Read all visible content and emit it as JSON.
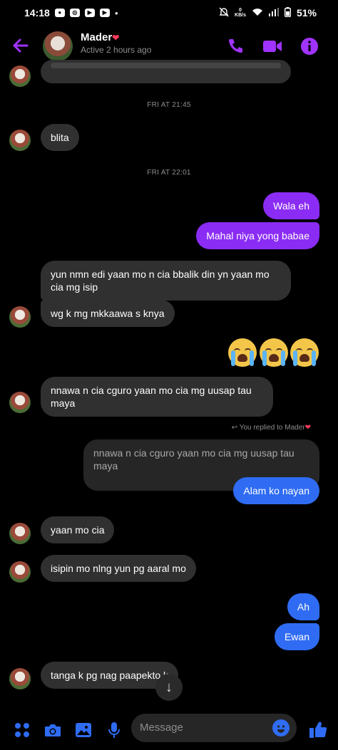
{
  "status_bar": {
    "time": "14:18",
    "kbs_value": "0",
    "kbs_unit": "KB/s",
    "battery": "51%"
  },
  "header": {
    "name": "Mader",
    "heart": "❤",
    "status": "Active 2 hours ago"
  },
  "timestamps": {
    "first": "FRI AT 21:45",
    "second": "FRI AT 22:01"
  },
  "messages": {
    "m1": "blita",
    "m2": "Wala eh",
    "m3": "Mahal niya yong babae",
    "m4": "yun nmn edi yaan mo n cia bbalik din yn yaan mo cia mg isip",
    "m5": "wg k mg mkkaawa s knya",
    "m6": "nnawa n cia cguro yaan mo cia mg uusap tau maya",
    "reply_note": "You replied to Mader",
    "quoted": "nnawa n cia cguro yaan mo cia mg uusap tau maya",
    "m7": "Alam ko nayan",
    "m8": "yaan mo cia",
    "m9": "isipin mo nlng yun pg  aaral mo",
    "m10": "Ah",
    "m11": "Ewan",
    "m12": "tanga k pg nag paapekto k"
  },
  "composer": {
    "placeholder": "Message"
  },
  "colors": {
    "accent_purple": "#8b2cf5",
    "accent_blue": "#2f6cf3",
    "bubble_incoming": "#303030"
  },
  "icons": [
    "back-arrow-icon",
    "phone-icon",
    "video-icon",
    "info-icon",
    "menu-dots-icon",
    "camera-icon",
    "gallery-icon",
    "mic-icon",
    "emoji-icon",
    "thumbs-up-icon",
    "arrow-down-icon"
  ]
}
